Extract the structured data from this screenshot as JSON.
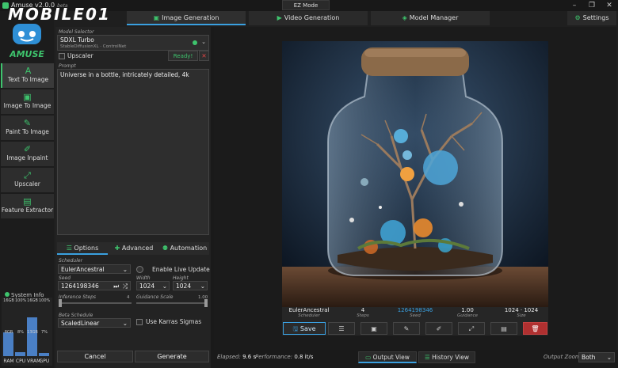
{
  "window": {
    "title": "Amuse v2.0.0",
    "beta": "beta",
    "watermark": "MOBILE01",
    "mode": "EZ Mode"
  },
  "brand": {
    "logo_text": "AMUSE"
  },
  "sidebar": {
    "items": [
      {
        "label": "Text To Image",
        "icon": "text-icon"
      },
      {
        "label": "Image To Image",
        "icon": "image-icon"
      },
      {
        "label": "Paint To Image",
        "icon": "paint-icon"
      },
      {
        "label": "Image Inpaint",
        "icon": "inpaint-icon"
      },
      {
        "label": "Upscaler",
        "icon": "upscale-icon"
      },
      {
        "label": "Feature Extractor",
        "icon": "feature-icon"
      }
    ]
  },
  "sysinfo": {
    "title": "System Info",
    "bars": [
      {
        "label": "RAM",
        "total": "16GB",
        "used": "8GB",
        "fill": 0.5
      },
      {
        "label": "CPU",
        "total": "100%",
        "used": "8%",
        "fill": 0.08
      },
      {
        "label": "VRAM",
        "total": "16GB",
        "used": "13GB",
        "fill": 0.81
      },
      {
        "label": "GPU",
        "total": "100%",
        "used": "7%",
        "fill": 0.07
      }
    ]
  },
  "tabs": [
    {
      "label": "Image Generation"
    },
    {
      "label": "Video Generation"
    },
    {
      "label": "Model Manager"
    }
  ],
  "settings_label": "Settings",
  "model": {
    "section": "Model Selector",
    "name": "SDXL Turbo",
    "sub": "StableDiffusionXL · ControlNet"
  },
  "upscaler": {
    "label": "Upscaler",
    "status": "Ready!"
  },
  "prompt": {
    "label": "Prompt",
    "value": "Universe in a bottle, intricately detailed, 4k"
  },
  "option_tabs": [
    "Options",
    "Advanced",
    "Automation"
  ],
  "options": {
    "scheduler_label": "Scheduler",
    "scheduler": "EulerAncestral",
    "live_update": "Enable Live Update",
    "seed_label": "Seed",
    "seed": "1264198346",
    "width_label": "Width",
    "width": "1024",
    "height_label": "Height",
    "height": "1024",
    "steps_label": "Inference Steps",
    "steps": "4",
    "guidance_label": "Guidance Scale",
    "guidance": "1.00",
    "beta_label": "Beta Schedule",
    "beta": "ScaledLinear",
    "karras": "Use Karras Sigmas"
  },
  "actions": {
    "cancel": "Cancel",
    "generate": "Generate"
  },
  "result": {
    "meta": [
      {
        "value": "EulerAncestral",
        "label": "Scheduler"
      },
      {
        "value": "4",
        "label": "Steps"
      },
      {
        "value": "1264198346",
        "label": "Seed"
      },
      {
        "value": "1.00",
        "label": "Guidance"
      },
      {
        "value": "1024 · 1024",
        "label": "Size"
      }
    ],
    "save": "Save"
  },
  "status": {
    "elapsed_label": "Elapsed:",
    "elapsed": "9.6 s",
    "perf_label": "Performance:",
    "perf": "0.8 it/s",
    "output_view": "Output View",
    "history_view": "History View",
    "zoom_label": "Output Zoom:",
    "zoom": "Both"
  },
  "colors": {
    "accent": "#3ec46d",
    "blue": "#3aa0e0",
    "delete": "#c0392b"
  }
}
